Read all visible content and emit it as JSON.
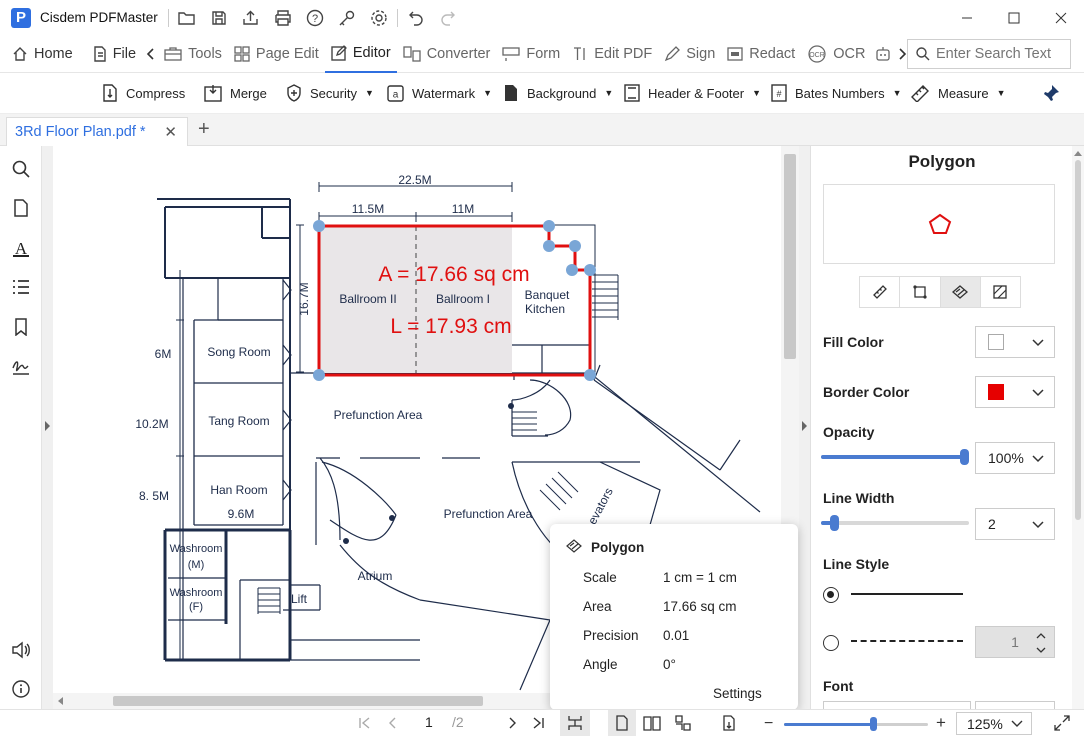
{
  "app": {
    "title": "Cisdem PDFMaster",
    "logo_letter": "P"
  },
  "menu": {
    "items": [
      {
        "label": "Home",
        "icon": "home-icon"
      },
      {
        "label": "File",
        "icon": "file-icon"
      },
      {
        "label": "Tools",
        "icon": "tools-icon"
      },
      {
        "label": "Page Edit",
        "icon": "page-edit-icon"
      },
      {
        "label": "Editor",
        "icon": "editor-icon"
      },
      {
        "label": "Converter",
        "icon": "converter-icon"
      },
      {
        "label": "Form",
        "icon": "form-icon"
      },
      {
        "label": "Edit PDF",
        "icon": "edit-pdf-icon"
      },
      {
        "label": "Sign",
        "icon": "sign-icon"
      },
      {
        "label": "Redact",
        "icon": "redact-icon"
      },
      {
        "label": "OCR",
        "icon": "ocr-icon"
      }
    ],
    "search_placeholder": "Enter Search Text"
  },
  "toolbar": {
    "items": [
      {
        "label": "Compress",
        "has_dropdown": false
      },
      {
        "label": "Merge",
        "has_dropdown": false
      },
      {
        "label": "Security",
        "has_dropdown": true
      },
      {
        "label": "Watermark",
        "has_dropdown": true
      },
      {
        "label": "Background",
        "has_dropdown": true
      },
      {
        "label": "Header & Footer",
        "has_dropdown": true
      },
      {
        "label": "Bates Numbers",
        "has_dropdown": true
      },
      {
        "label": "Measure",
        "has_dropdown": true
      }
    ]
  },
  "tab": {
    "label": "3Rd Floor Plan.pdf *"
  },
  "plan": {
    "dim_total": "22.5M",
    "dim_a": "11.5M",
    "dim_b": "11M",
    "dim_v": "16.7M",
    "dim_6": "6M",
    "dim_10": "10.2M",
    "dim_8": "8. 5M",
    "dim_96": "9.6M",
    "rooms": {
      "ballroom2": "Ballroom II",
      "ballroom1": "Ballroom I",
      "banquet1": "Banquet",
      "banquet2": "Kitchen",
      "song": "Song Room",
      "tang": "Tang Room",
      "han": "Han Room",
      "prefunction1": "Prefunction Area",
      "prefunction2": "Prefunction Area",
      "atrium": "Atrium",
      "washroom_m1": "Washroom",
      "washroom_m2": "(M)",
      "washroom_f1": "Washroom",
      "washroom_f2": "(F)",
      "lift": "Lift",
      "elevators": "evators"
    },
    "area_annotation": "A = 17.66 sq cm",
    "length_annotation": "L = 17.93 cm"
  },
  "popup": {
    "title": "Polygon",
    "rows": [
      {
        "label": "Scale",
        "value": "1 cm = 1 cm"
      },
      {
        "label": "Area",
        "value": "17.66 sq cm"
      },
      {
        "label": "Precision",
        "value": "0.01"
      },
      {
        "label": "Angle",
        "value": "0°"
      }
    ],
    "settings": "Settings"
  },
  "panel": {
    "title": "Polygon",
    "fill_color_label": "Fill Color",
    "fill_color": "#ffffff",
    "border_color_label": "Border Color",
    "border_color": "#e60000",
    "opacity_label": "Opacity",
    "opacity": "100%",
    "opacity_fraction": 1.0,
    "line_width_label": "Line Width",
    "line_width": "2",
    "line_width_fraction": 0.09,
    "line_style_label": "Line Style",
    "dash_value": "1",
    "font_label": "Font"
  },
  "status": {
    "page_current": "1",
    "page_total": "/2",
    "zoom": "125%",
    "zoom_fraction": 0.62
  },
  "colors": {
    "accent": "#2f6fe0",
    "measure_red": "#e01010",
    "handle": "#7aa6d6"
  }
}
